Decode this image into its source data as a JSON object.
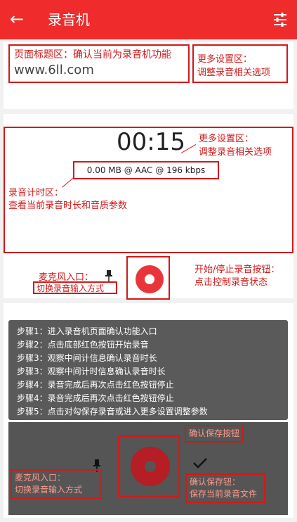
{
  "appbar": {
    "back_icon": "←",
    "title": "录音机",
    "settings_icon": "tune-icon"
  },
  "annotations": {
    "title_area": "页面标题区：确认当前为录音机功能",
    "watermark": "www.6ll.com",
    "more_settings_1_line1": "更多设置区：",
    "more_settings_1_line2": "调整录音相关选项",
    "more_settings_2_line1": "更多设置区：",
    "more_settings_2_line2": "调整录音相关选项",
    "timer_area_line1": "录音计时区：",
    "timer_area_line2": "查看当前录音时长和音质参数",
    "mic_input_line1": "麦克风入口：",
    "mic_input_line2": "切换录音输入方式",
    "start_stop_line1": "开始/停止录音按钮：",
    "start_stop_line2": "点击控制录音状态",
    "confirm_save": "确认保存按钮",
    "confirm_save_line1": "确认保存钮：",
    "confirm_save_line2": "保存当前录音文件",
    "mic_input_2_line1": "麦克风入口：",
    "mic_input_2_line2": "切换录音输入方式"
  },
  "recorder": {
    "timer": "00:15",
    "stats": "0.00 MB @ AAC @ 196 kbps"
  },
  "steps": [
    "步骤1：进入录音机页面确认功能入口",
    "步骤2：点击底部红色按钮开始录音",
    "步骤3：观察中间计信息确认录音时长",
    "步骤3：观察中间计时信息确认录音时长",
    "步骤4：录音完成后再次点击红色按钮停止",
    "步骤4：录音完成后再次点击红色按钮停止",
    "步骤5：点击对勾保存录音或进入更多设置调整参数"
  ],
  "colors": {
    "appbar": "#ef2b2b",
    "annotation": "#d01a1a",
    "record": "#e9353a"
  }
}
